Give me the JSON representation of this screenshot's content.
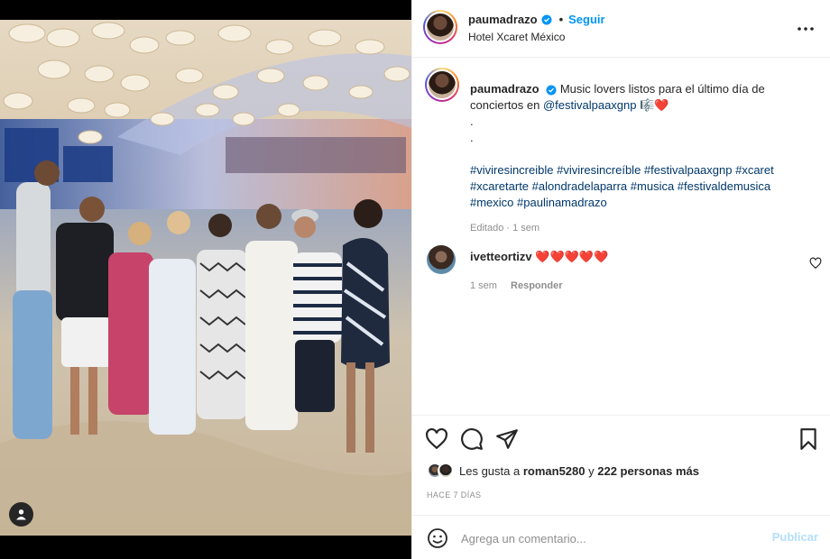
{
  "post": {
    "username": "paumadrazo",
    "follow_label": "Seguir",
    "location": "Hotel Xcaret México",
    "separator": "•"
  },
  "caption": {
    "username": "paumadrazo",
    "text": "Music lovers listos para el último día de conciertos en",
    "mention": "@festivalpaaxgnp",
    "emojis": "🎼❤️",
    "dot1": ".",
    "dot2": ".",
    "hashtags": "#viviresincreible #viviresincreíble #festivalpaaxgnp #xcaret #xcaretarte #alondradelaparra #musica #festivaldemusica #mexico #paulinamadrazo",
    "meta": "Editado · 1 sem"
  },
  "comment": {
    "username": "ivetteortizv",
    "text": "❤️❤️❤️❤️❤️",
    "time": "1 sem",
    "reply_label": "Responder"
  },
  "likes": {
    "prefix": "Les gusta a",
    "user": "roman5280",
    "conjunction": "y",
    "others": "222 personas más"
  },
  "time_ago": "HACE 7 DÍAS",
  "add_comment": {
    "placeholder": "Agrega un comentario...",
    "publish_label": "Publicar"
  },
  "icons": {
    "verified": "verified-badge-icon",
    "more": "more-options-icon",
    "like": "heart-icon",
    "comment": "comment-icon",
    "share": "send-icon",
    "save": "bookmark-icon",
    "emoji": "emoji-icon",
    "user_tag": "user-tag-icon"
  },
  "colors": {
    "accent": "#0095f6",
    "link": "#00376b",
    "muted": "#8e8e8e",
    "publish_disabled": "#b2dffc",
    "verified": "#0095f6"
  }
}
